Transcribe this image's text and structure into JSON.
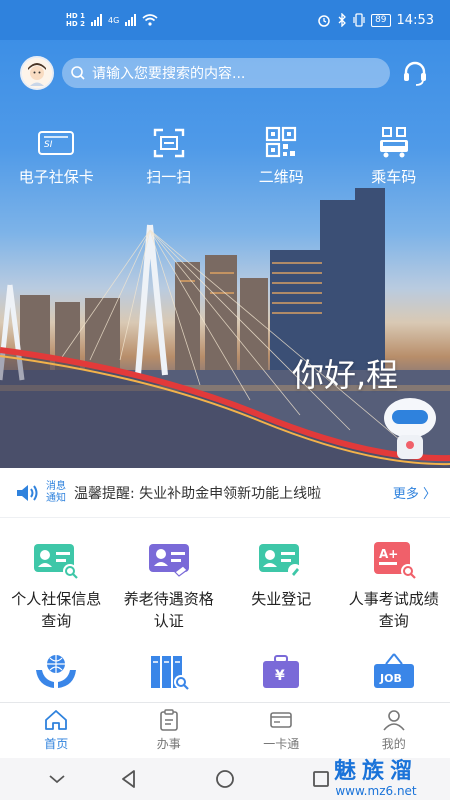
{
  "status_bar": {
    "sim_labels": [
      "HD 1",
      "HD 2"
    ],
    "network": "4G",
    "battery": "89",
    "time": "14:53"
  },
  "header": {
    "search_placeholder": "请输入您要搜索的内容..."
  },
  "quick_actions": [
    {
      "label": "电子社保卡",
      "icon": "social-security-card-icon"
    },
    {
      "label": "扫一扫",
      "icon": "scan-icon"
    },
    {
      "label": "二维码",
      "icon": "qr-code-icon"
    },
    {
      "label": "乘车码",
      "icon": "bus-code-icon"
    }
  ],
  "banner": {
    "greeting": "你好,程"
  },
  "notice": {
    "tag_line1": "消息",
    "tag_line2": "通知",
    "text": "温馨提醒: 失业补助金申领新功能上线啦",
    "more": "更多 〉"
  },
  "services": [
    {
      "label": "个人社保信息查询",
      "icon": "id-card-search-icon"
    },
    {
      "label": "养老待遇资格认证",
      "icon": "pension-certification-icon"
    },
    {
      "label": "失业登记",
      "icon": "unemployment-registration-icon"
    },
    {
      "label": "人事考试成绩查询",
      "icon": "exam-score-icon"
    },
    {
      "label": "",
      "icon": "globe-hands-icon"
    },
    {
      "label": "",
      "icon": "archive-search-icon"
    },
    {
      "label": "",
      "icon": "yuan-briefcase-icon"
    },
    {
      "label": "",
      "icon": "job-sign-icon"
    }
  ],
  "tabs": [
    {
      "label": "首页",
      "icon": "home-icon",
      "active": true
    },
    {
      "label": "办事",
      "icon": "clipboard-icon",
      "active": false
    },
    {
      "label": "一卡通",
      "icon": "card-icon",
      "active": false
    },
    {
      "label": "我的",
      "icon": "user-icon",
      "active": false
    }
  ],
  "watermark": {
    "name": "魅族溜",
    "url": "www.mz6.net"
  },
  "colors": {
    "primary": "#2f82dd",
    "icon_green": "#3ec7a8",
    "icon_purple": "#7a6ad8",
    "icon_red": "#f0606a",
    "icon_blue": "#3a86e8"
  }
}
